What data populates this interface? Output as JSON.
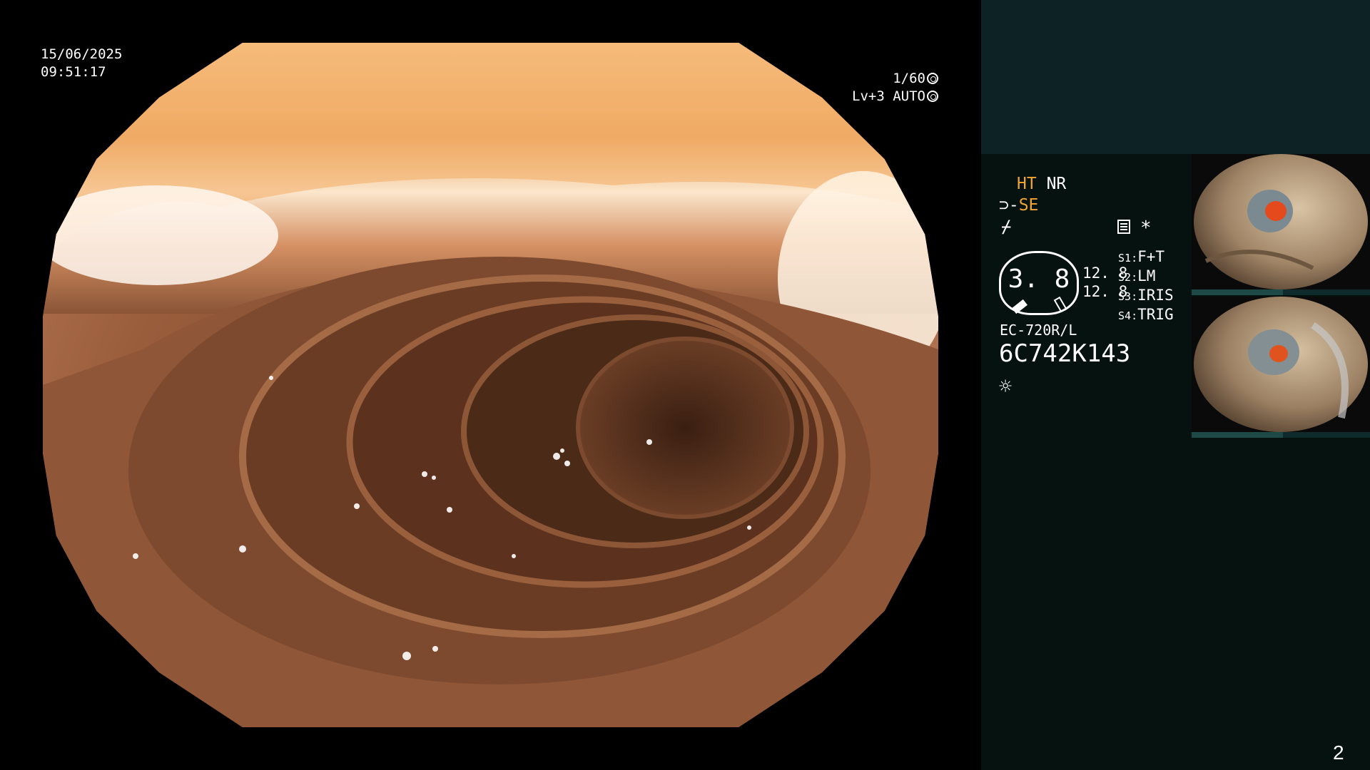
{
  "overlay": {
    "date": "15/06/2025",
    "time": "09:51:17",
    "shutter": "1/60",
    "level": "Lv+3",
    "mode": "AUTO",
    "shutter_icon": "aperture-icon",
    "mode_icon": "auto-iris-icon"
  },
  "panel": {
    "ht": "HT",
    "nr": "NR",
    "se": "SE",
    "se_icon": "structure-enhance-icon",
    "f_icon_glyph": "⌿",
    "doc_icon": "record-icon",
    "star": "*",
    "gauge_value": "3. 8",
    "values": [
      "12. 8",
      "12. 8"
    ],
    "switches": [
      {
        "key": "S1",
        "value": "F+T"
      },
      {
        "key": "S2",
        "value": "LM"
      },
      {
        "key": "S3",
        "value": "IRIS"
      },
      {
        "key": "S4",
        "value": "TRIG"
      }
    ],
    "model": "EC-720R/L",
    "serial": "6C742K143",
    "light_icon": "☼",
    "page_number": "2"
  },
  "colors": {
    "panel_bg": "#051210",
    "panel_top_bg": "#0c2224",
    "accent": "#f2a531"
  }
}
